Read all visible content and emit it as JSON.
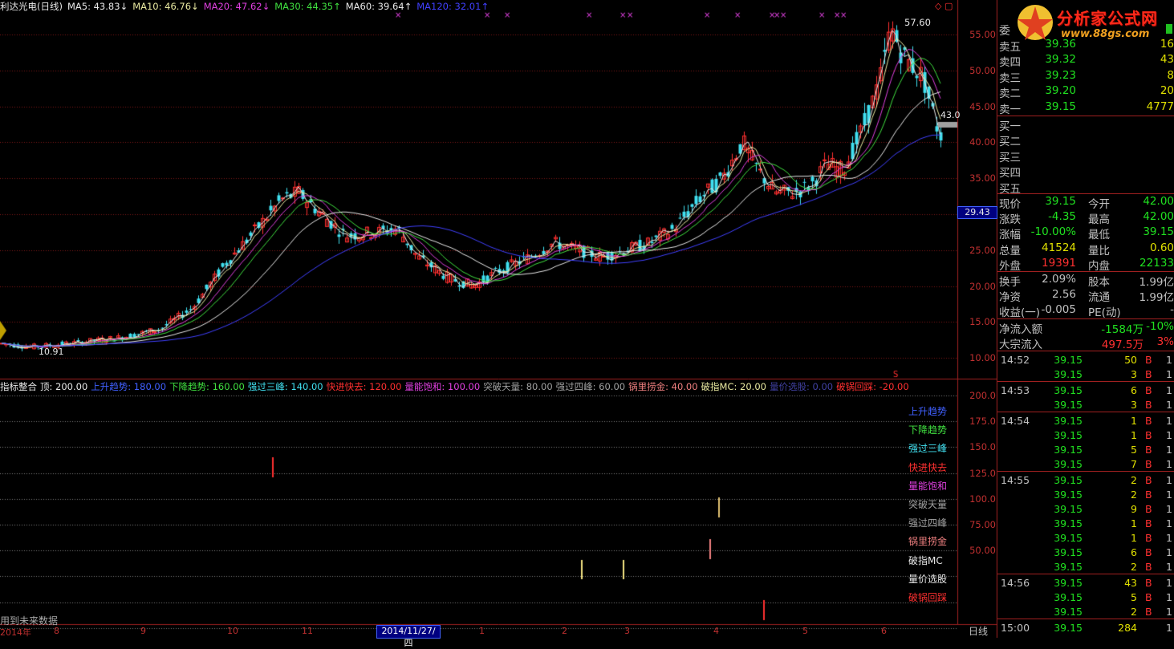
{
  "main_chart": {
    "stock_name": "利达光电(日线)",
    "ma_labels": [
      {
        "text": "MA5: 43.83↓",
        "color": "#e8e8e8"
      },
      {
        "text": "MA10: 46.76↓",
        "color": "#e8e8a0"
      },
      {
        "text": "MA20: 47.62↓",
        "color": "#e040e0"
      },
      {
        "text": "MA30: 44.35↑",
        "color": "#40e040"
      },
      {
        "text": "MA60: 39.64↑",
        "color": "#e8e8e8"
      },
      {
        "text": "MA120: 32.01↑",
        "color": "#4040ff"
      }
    ],
    "y_ticks": [
      "55.00",
      "50.00",
      "45.00",
      "40.00",
      "35.00",
      "30.00",
      "25.00",
      "20.00",
      "15.00",
      "10.00"
    ],
    "high_label": "57.60",
    "low_label": "10.91",
    "last_label": "43.0",
    "cursor_price": "29.43",
    "colors": {
      "up": "#ff3030",
      "down": "#40e0f0",
      "grid": "#801818",
      "ma5": "#e8e8e8",
      "ma10": "#e8e8a0",
      "ma20": "#e040e0",
      "ma30": "#40e040",
      "ma60": "#e8e8e8",
      "ma120": "#4040ff"
    }
  },
  "indicator": {
    "title": "指标整合",
    "params": [
      {
        "text": "顶: 200.00",
        "color": "#e8e8e8"
      },
      {
        "text": "上升趋势: 180.00",
        "color": "#4060ff"
      },
      {
        "text": "下降趋势: 160.00",
        "color": "#40e040"
      },
      {
        "text": "强过三峰: 140.00",
        "color": "#40e0f0"
      },
      {
        "text": "快进快去: 120.00",
        "color": "#ff3030"
      },
      {
        "text": "量能饱和: 100.00",
        "color": "#e040e0"
      },
      {
        "text": "突破天量: 80.00",
        "color": "#a0a0a0"
      },
      {
        "text": "强过四峰: 60.00",
        "color": "#a0a0a0"
      },
      {
        "text": "锅里捞金: 40.00",
        "color": "#f08080"
      },
      {
        "text": "破指MC: 20.00",
        "color": "#e8e8a0"
      },
      {
        "text": "量价选股: 0.00",
        "color": "#4040a0"
      },
      {
        "text": "破锅回踩: -20.00",
        "color": "#ff3030"
      }
    ],
    "y_ticks": [
      "200.0",
      "175.0",
      "150.0",
      "125.0",
      "100.0",
      "75.00",
      "50.00"
    ],
    "signals": [
      {
        "label": "上升趋势",
        "color": "#4060ff"
      },
      {
        "label": "下降趋势",
        "color": "#40e040"
      },
      {
        "label": "强过三峰",
        "color": "#40e0f0"
      },
      {
        "label": "快进快去",
        "color": "#ff3030"
      },
      {
        "label": "量能饱和",
        "color": "#e040e0"
      },
      {
        "label": "突破天量",
        "color": "#a0a0a0"
      },
      {
        "label": "强过四峰",
        "color": "#a0a0a0"
      },
      {
        "label": "锅里捞金",
        "color": "#f08080"
      },
      {
        "label": "破指MC",
        "color": "#e8e8e8"
      },
      {
        "label": "量价选股",
        "color": "#e8e8e8"
      },
      {
        "label": "破锅回踩",
        "color": "#ff3030"
      }
    ],
    "note": "用到未来数据"
  },
  "x_axis": {
    "labels": [
      "2014年",
      "8",
      "9",
      "10",
      "11",
      "1",
      "2",
      "3",
      "4",
      "5",
      "6"
    ],
    "cursor_date": "2014/11/27/四",
    "period": "日线"
  },
  "logo": {
    "title": "分析家公式网",
    "url": "www.88gs.com"
  },
  "order_book": {
    "header": "委",
    "sells": [
      {
        "k": "卖五",
        "p": "39.36",
        "v": "16"
      },
      {
        "k": "卖四",
        "p": "39.32",
        "v": "43"
      },
      {
        "k": "卖三",
        "p": "39.23",
        "v": "8"
      },
      {
        "k": "卖二",
        "p": "39.20",
        "v": "20"
      },
      {
        "k": "卖一",
        "p": "39.15",
        "v": "4777"
      }
    ],
    "buys": [
      {
        "k": "买一",
        "p": "",
        "v": ""
      },
      {
        "k": "买二",
        "p": "",
        "v": ""
      },
      {
        "k": "买三",
        "p": "",
        "v": ""
      },
      {
        "k": "买四",
        "p": "",
        "v": ""
      },
      {
        "k": "买五",
        "p": "",
        "v": ""
      }
    ]
  },
  "quote": {
    "rows": [
      {
        "k1": "现价",
        "v1": "39.15",
        "c1": "#20e020",
        "k2": "今开",
        "v2": "42.00",
        "c2": "#20e020"
      },
      {
        "k1": "涨跌",
        "v1": "-4.35",
        "c1": "#20e020",
        "k2": "最高",
        "v2": "42.00",
        "c2": "#20e020"
      },
      {
        "k1": "涨幅",
        "v1": "-10.00%",
        "c1": "#20e020",
        "k2": "最低",
        "v2": "39.15",
        "c2": "#20e020"
      },
      {
        "k1": "总量",
        "v1": "41524",
        "c1": "#e0e000",
        "k2": "量比",
        "v2": "0.60",
        "c2": "#e0e000"
      },
      {
        "k1": "外盘",
        "v1": "19391",
        "c1": "#ff3030",
        "k2": "内盘",
        "v2": "22133",
        "c2": "#20e020"
      }
    ],
    "rows2": [
      {
        "k1": "换手",
        "v1": "2.09%",
        "c1": "#c0c0c0",
        "k2": "股本",
        "v2": "1.99亿",
        "c2": "#c0c0c0"
      },
      {
        "k1": "净资",
        "v1": "2.56",
        "c1": "#c0c0c0",
        "k2": "流通",
        "v2": "1.99亿",
        "c2": "#c0c0c0"
      },
      {
        "k1": "收益(一)",
        "v1": "-0.005",
        "c1": "#c0c0c0",
        "k2": "PE(动)",
        "v2": "-",
        "c2": "#c0c0c0"
      }
    ],
    "flow": [
      {
        "k": "净流入额",
        "v": "-1584万",
        "pct": "-10%",
        "c": "#20e020"
      },
      {
        "k": "大宗流入",
        "v": "497.5万",
        "pct": "3%",
        "c": "#ff3030"
      }
    ]
  },
  "ticks": [
    {
      "t": "14:52",
      "p": "39.15",
      "v": "50",
      "bs": "B"
    },
    {
      "t": "",
      "p": "39.15",
      "v": "3",
      "bs": "B"
    },
    {
      "t": "14:53",
      "p": "39.15",
      "v": "6",
      "bs": "B"
    },
    {
      "t": "",
      "p": "39.15",
      "v": "3",
      "bs": "B"
    },
    {
      "t": "14:54",
      "p": "39.15",
      "v": "1",
      "bs": "B"
    },
    {
      "t": "",
      "p": "39.15",
      "v": "1",
      "bs": "B"
    },
    {
      "t": "",
      "p": "39.15",
      "v": "5",
      "bs": "B"
    },
    {
      "t": "",
      "p": "39.15",
      "v": "7",
      "bs": "B"
    },
    {
      "t": "14:55",
      "p": "39.15",
      "v": "2",
      "bs": "B"
    },
    {
      "t": "",
      "p": "39.15",
      "v": "2",
      "bs": "B"
    },
    {
      "t": "",
      "p": "39.15",
      "v": "9",
      "bs": "B"
    },
    {
      "t": "",
      "p": "39.15",
      "v": "1",
      "bs": "B"
    },
    {
      "t": "",
      "p": "39.15",
      "v": "1",
      "bs": "B"
    },
    {
      "t": "",
      "p": "39.15",
      "v": "6",
      "bs": "B"
    },
    {
      "t": "",
      "p": "39.15",
      "v": "2",
      "bs": "B"
    },
    {
      "t": "14:56",
      "p": "39.15",
      "v": "43",
      "bs": "B"
    },
    {
      "t": "",
      "p": "39.15",
      "v": "5",
      "bs": "B"
    },
    {
      "t": "",
      "p": "39.15",
      "v": "2",
      "bs": "B"
    },
    {
      "t": "15:00",
      "p": "39.15",
      "v": "284",
      "bs": ""
    }
  ],
  "tick_last_col": [
    "1",
    "1",
    "1",
    "1",
    "1",
    "1",
    "1",
    "1",
    "1",
    "1",
    "1",
    "1",
    "1",
    "1",
    "1",
    "1",
    "1",
    "1",
    "1"
  ]
}
